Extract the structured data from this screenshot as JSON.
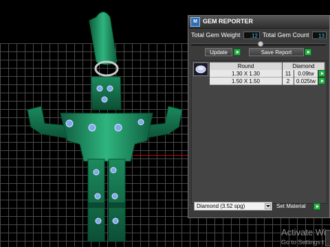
{
  "viewport": {
    "description_icon": "jewelry-figure-pendant"
  },
  "panel": {
    "title": "GEM REPORTER",
    "total_weight_label": "Total Gem Weight",
    "total_weight_value": ".12",
    "total_count_label": "Total Gem Count",
    "total_count_value": "13",
    "update_label": "Update",
    "save_report_label": "Save Report",
    "headers": [
      "Round",
      "Diamond"
    ],
    "rows": [
      {
        "size": "1.30 X 1.30",
        "count": "11",
        "weight": "0.09tw"
      },
      {
        "size": "1.50 X 1.50",
        "count": "2",
        "weight": "0.025tw"
      }
    ],
    "material_select": "Diamond      (3.52 spg)",
    "set_material_label": "Set Material"
  },
  "watermark": {
    "line1": "Activate Wind",
    "line2": "Go to Settings t"
  },
  "colors": {
    "accent_green": "#2bb34a",
    "value_blue": "#44c8f0",
    "model_green": "#1e9a6a"
  }
}
